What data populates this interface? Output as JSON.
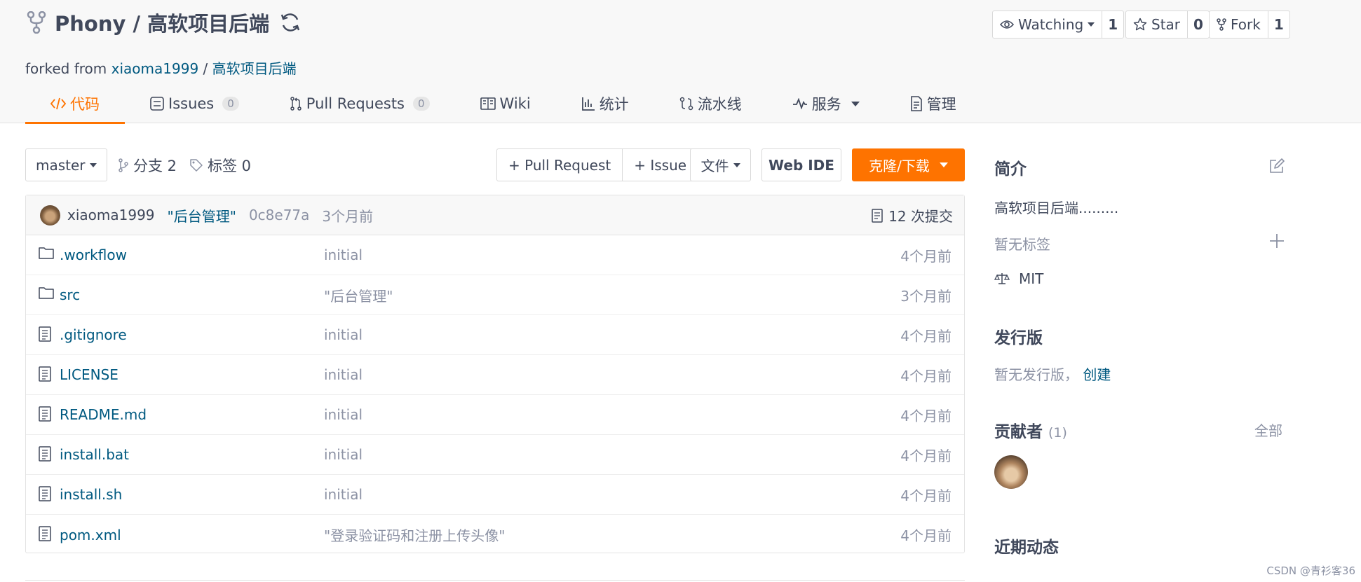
{
  "repo": {
    "name": "Phony / 高软项目后端",
    "forked_prefix": "forked from",
    "forked_owner": "xiaoma1999",
    "forked_sep": "/",
    "forked_repo": "高软项目后端"
  },
  "social": {
    "watch_label": "Watching",
    "watch_count": "1",
    "star_label": "Star",
    "star_count": "0",
    "fork_label": "Fork",
    "fork_count": "1"
  },
  "tabs": [
    {
      "label": "代码",
      "icon": "code-icon",
      "badge": ""
    },
    {
      "label": "Issues",
      "icon": "issues-icon",
      "badge": "0"
    },
    {
      "label": "Pull Requests",
      "icon": "pull-request-icon",
      "badge": "0"
    },
    {
      "label": "Wiki",
      "icon": "book-icon",
      "badge": ""
    },
    {
      "label": "统计",
      "icon": "stats-icon",
      "badge": ""
    },
    {
      "label": "流水线",
      "icon": "pipeline-icon",
      "badge": ""
    },
    {
      "label": "服务",
      "icon": "pulse-icon",
      "badge": ""
    },
    {
      "label": "管理",
      "icon": "document-icon",
      "badge": ""
    }
  ],
  "toolbar": {
    "branch": "master",
    "branches": "分支 2",
    "tags": "标签 0",
    "pull_request": "+ Pull Request",
    "issue": "+ Issue",
    "file": "文件",
    "web_ide": "Web IDE",
    "clone": "克隆/下载"
  },
  "latest_commit": {
    "author": "xiaoma1999",
    "message": "\"后台管理\"",
    "sha": "0c8e77a",
    "ago": "3个月前",
    "count": "12 次提交"
  },
  "files": [
    {
      "type": "folder",
      "name": ".workflow",
      "message": "initial",
      "time": "4个月前"
    },
    {
      "type": "folder",
      "name": "src",
      "message": "\"后台管理\"",
      "time": "3个月前"
    },
    {
      "type": "file",
      "name": ".gitignore",
      "message": "initial",
      "time": "4个月前"
    },
    {
      "type": "file",
      "name": "LICENSE",
      "message": "initial",
      "time": "4个月前"
    },
    {
      "type": "file",
      "name": "README.md",
      "message": "initial",
      "time": "4个月前"
    },
    {
      "type": "file",
      "name": "install.bat",
      "message": "initial",
      "time": "4个月前"
    },
    {
      "type": "file",
      "name": "install.sh",
      "message": "initial",
      "time": "4个月前"
    },
    {
      "type": "file",
      "name": "pom.xml",
      "message": "\"登录验证码和注册上传头像\"",
      "time": "4个月前"
    }
  ],
  "sidebar": {
    "intro_title": "简介",
    "intro_text": "高软项目后端.........",
    "no_tags": "暂无标签",
    "license": "MIT",
    "release_title": "发行版",
    "no_release": "暂无发行版，",
    "create": "创建",
    "contrib_title": "贡献者",
    "contrib_count": "(1)",
    "all": "全部",
    "activity_title": "近期动态"
  },
  "watermark": "CSDN @青衫客36",
  "colors": {
    "accent": "#fe7300",
    "link": "#005980",
    "muted": "#8c92a4",
    "text": "#40485b"
  }
}
